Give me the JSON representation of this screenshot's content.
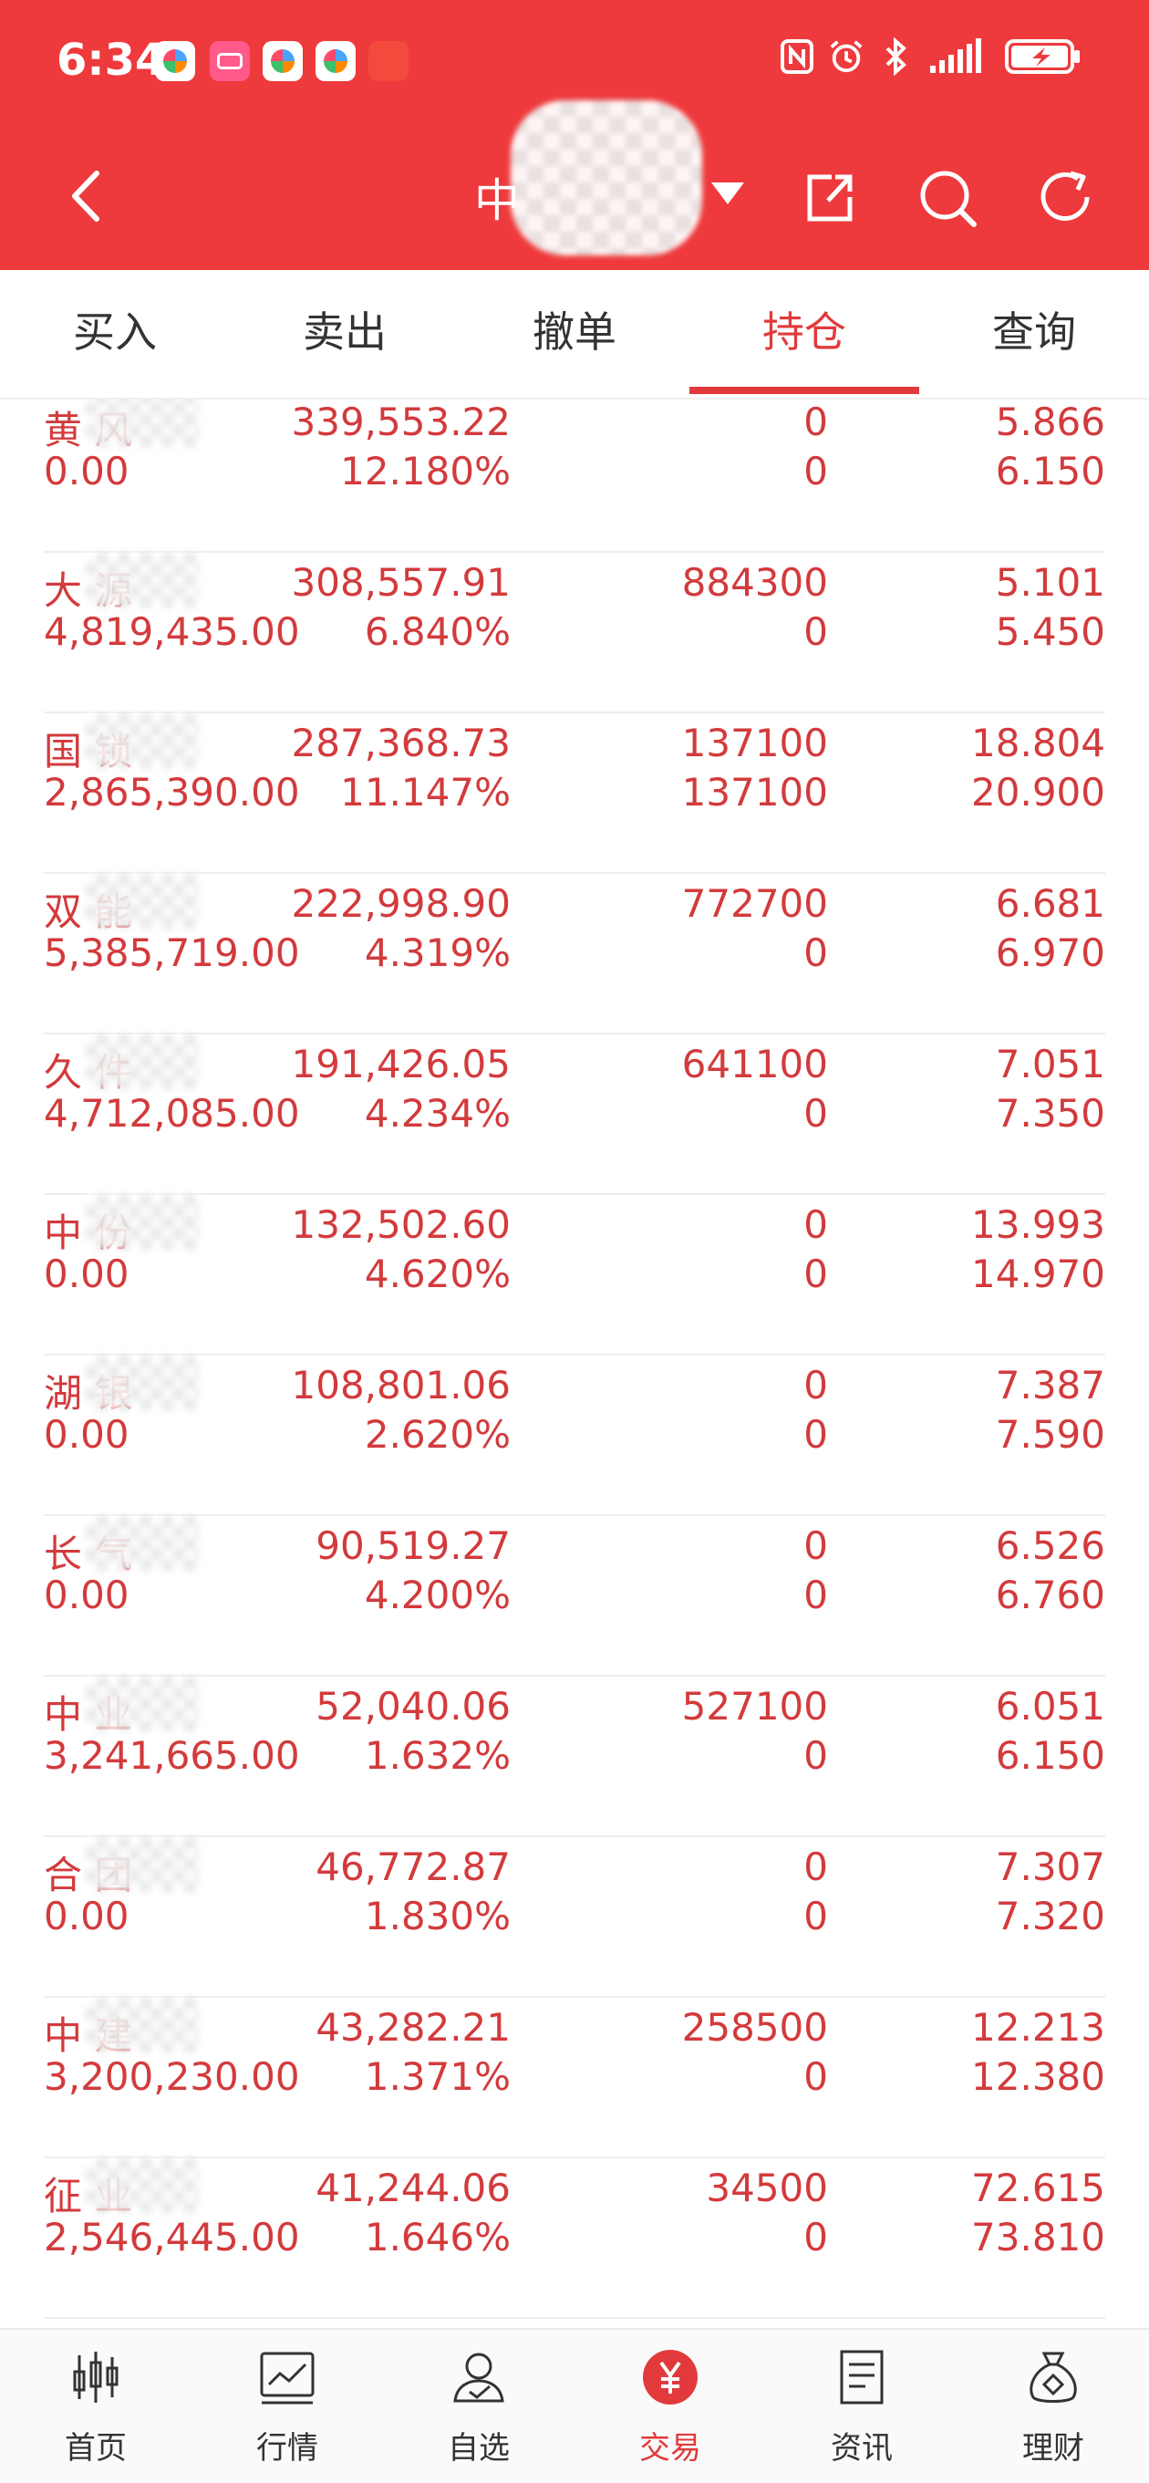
{
  "status_bar": {
    "time": "6:34"
  },
  "header": {
    "title_visible": "中"
  },
  "tabs": [
    {
      "label": "买入"
    },
    {
      "label": "卖出"
    },
    {
      "label": "撤单"
    },
    {
      "label": "持仓",
      "active": true
    },
    {
      "label": "查询"
    }
  ],
  "holdings": [
    {
      "name": "黄 风",
      "amount": "0.00",
      "value": "339,553.22",
      "ratio": "12.180%",
      "qty": "0",
      "avail": "0",
      "cost": "5.866",
      "price": "6.150"
    },
    {
      "name": "大 源",
      "amount": "4,819,435.00",
      "value": "308,557.91",
      "ratio": "6.840%",
      "qty": "884300",
      "avail": "0",
      "cost": "5.101",
      "price": "5.450"
    },
    {
      "name": "国 锁",
      "amount": "2,865,390.00",
      "value": "287,368.73",
      "ratio": "11.147%",
      "qty": "137100",
      "avail": "137100",
      "cost": "18.804",
      "price": "20.900"
    },
    {
      "name": "双 能",
      "amount": "5,385,719.00",
      "value": "222,998.90",
      "ratio": "4.319%",
      "qty": "772700",
      "avail": "0",
      "cost": "6.681",
      "price": "6.970"
    },
    {
      "name": "久 件",
      "amount": "4,712,085.00",
      "value": "191,426.05",
      "ratio": "4.234%",
      "qty": "641100",
      "avail": "0",
      "cost": "7.051",
      "price": "7.350"
    },
    {
      "name": "中 份",
      "amount": "0.00",
      "value": "132,502.60",
      "ratio": "4.620%",
      "qty": "0",
      "avail": "0",
      "cost": "13.993",
      "price": "14.970"
    },
    {
      "name": "湖 银",
      "amount": "0.00",
      "value": "108,801.06",
      "ratio": "2.620%",
      "qty": "0",
      "avail": "0",
      "cost": "7.387",
      "price": "7.590"
    },
    {
      "name": "长 气",
      "amount": "0.00",
      "value": "90,519.27",
      "ratio": "4.200%",
      "qty": "0",
      "avail": "0",
      "cost": "6.526",
      "price": "6.760"
    },
    {
      "name": "中 业",
      "amount": "3,241,665.00",
      "value": "52,040.06",
      "ratio": "1.632%",
      "qty": "527100",
      "avail": "0",
      "cost": "6.051",
      "price": "6.150"
    },
    {
      "name": "合 团",
      "amount": "0.00",
      "value": "46,772.87",
      "ratio": "1.830%",
      "qty": "0",
      "avail": "0",
      "cost": "7.307",
      "price": "7.320"
    },
    {
      "name": "中 建",
      "amount": "3,200,230.00",
      "value": "43,282.21",
      "ratio": "1.371%",
      "qty": "258500",
      "avail": "0",
      "cost": "12.213",
      "price": "12.380"
    },
    {
      "name": "征 业",
      "amount": "2,546,445.00",
      "value": "41,244.06",
      "ratio": "1.646%",
      "qty": "34500",
      "avail": "0",
      "cost": "72.615",
      "price": "73.810"
    }
  ],
  "bottom_nav": [
    {
      "label": "首页",
      "icon": "candlestick-icon"
    },
    {
      "label": "行情",
      "icon": "chart-icon"
    },
    {
      "label": "自选",
      "icon": "person-icon"
    },
    {
      "label": "交易",
      "icon": "yen-icon",
      "active": true
    },
    {
      "label": "资讯",
      "icon": "document-icon"
    },
    {
      "label": "理财",
      "icon": "money-bag-icon"
    }
  ]
}
